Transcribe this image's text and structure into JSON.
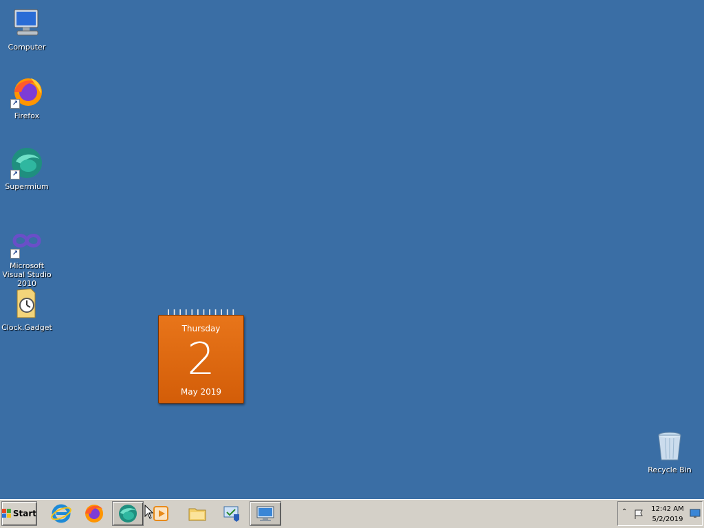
{
  "desktop": {
    "icons": [
      {
        "label": "Computer",
        "icon": "computer-icon"
      },
      {
        "label": "Firefox",
        "icon": "firefox-icon"
      },
      {
        "label": "Supermium",
        "icon": "supermium-icon"
      },
      {
        "label": "Microsoft Visual Studio 2010",
        "icon": "visual-studio-icon"
      },
      {
        "label": "Clock.Gadget",
        "icon": "clock-gadget-icon"
      },
      {
        "label": "Recycle Bin",
        "icon": "recycle-bin-icon"
      }
    ]
  },
  "calendar_gadget": {
    "weekday": "Thursday",
    "day": "2",
    "month_year": "May 2019"
  },
  "taskbar": {
    "start_label": "Start",
    "items": [
      {
        "icon": "internet-explorer-icon"
      },
      {
        "icon": "firefox-icon"
      },
      {
        "icon": "supermium-icon",
        "active": true
      },
      {
        "icon": "media-player-icon"
      },
      {
        "icon": "file-explorer-icon"
      },
      {
        "icon": "control-panel-icon"
      },
      {
        "icon": "remote-desktop-icon",
        "active": true
      }
    ],
    "tray": {
      "time": "12:42 AM",
      "date": "5/2/2019",
      "icons": [
        "show-hidden-icons-chevron",
        "action-center-flag-icon",
        "show-desktop-icon"
      ]
    }
  },
  "colors": {
    "desktop_background": "#3a6ea5",
    "taskbar": "#d4d0c8",
    "calendar_orange": "#e06a10"
  }
}
